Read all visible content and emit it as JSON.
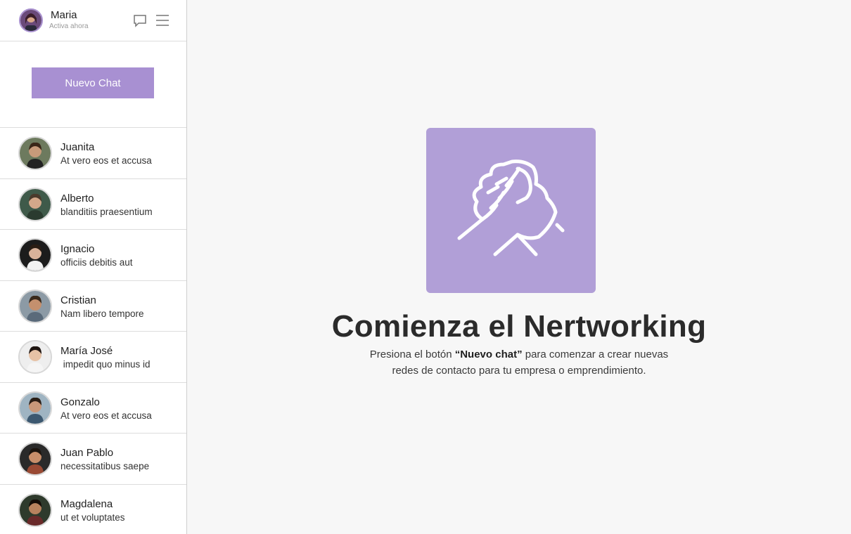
{
  "user": {
    "name": "Maria",
    "status": "Activa ahora"
  },
  "header_icons": {
    "chat": "chat-bubble-icon",
    "menu": "hamburger-menu-icon"
  },
  "new_chat_label": "Nuevo Chat",
  "chats": [
    {
      "name": "Juanita",
      "message": "At vero eos et accusa",
      "skin": "#c89a7a",
      "hair": "#3a2618",
      "bg": "#6d7a5e",
      "shirt": "#222222"
    },
    {
      "name": "Alberto",
      "message": "blanditiis praesentium",
      "skin": "#d4a88a",
      "hair": "#4a3a2c",
      "bg": "#3f5a4a",
      "shirt": "#2a3b2f"
    },
    {
      "name": "Ignacio",
      "message": "officiis debitis aut",
      "skin": "#d9b29a",
      "hair": "#2a1d14",
      "bg": "#1c1c1c",
      "shirt": "#f2f2f2"
    },
    {
      "name": "Cristian",
      "message": "Nam libero tempore",
      "skin": "#c4906e",
      "hair": "#3a2a1c",
      "bg": "#8c9aa5",
      "shirt": "#5a6a7a"
    },
    {
      "name": "María José",
      "message": " impedit quo minus id",
      "skin": "#e6c2a6",
      "hair": "#1e1410",
      "bg": "#eeeeee",
      "shirt": "#f5f5f5"
    },
    {
      "name": "Gonzalo",
      "message": "At vero eos et accusa",
      "skin": "#c8987a",
      "hair": "#2a1e16",
      "bg": "#9fb4c2",
      "shirt": "#3c5870"
    },
    {
      "name": "Juan Pablo",
      "message": "necessitatibus saepe",
      "skin": "#c88e6a",
      "hair": "#1c140e",
      "bg": "#2a2a2a",
      "shirt": "#9a4a34"
    },
    {
      "name": "Magdalena",
      "message": "ut et voluptates",
      "skin": "#b8825e",
      "hair": "#140c08",
      "bg": "#2e3a2c",
      "shirt": "#6a2a2a"
    }
  ],
  "hero": {
    "icon": "handshake-icon",
    "title": "Comienza el Nertworking",
    "desc_before": "Presiona el botón ",
    "desc_bold": "“Nuevo chat”",
    "desc_after": " para comenzar a crear nuevas",
    "desc_line2": "redes de contacto para tu empresa o emprendimiento."
  },
  "colors": {
    "accent": "#a890d2",
    "hero_bg": "#b19fd7",
    "page_bg": "#f7f7f7"
  }
}
